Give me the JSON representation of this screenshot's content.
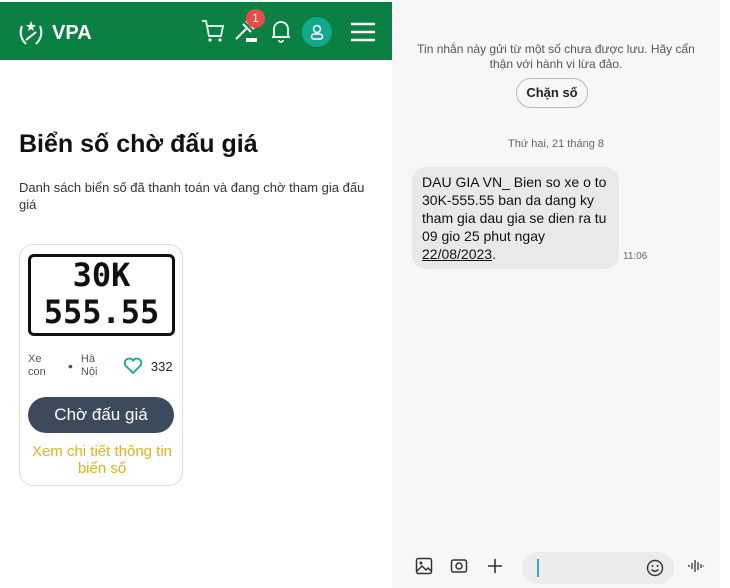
{
  "app": {
    "logo_text": "VPA",
    "notification_count": "1"
  },
  "page": {
    "title": "Biển số chờ đấu giá",
    "description": "Danh sách biển số đã thanh toán và đang chờ tham gia đấu giá"
  },
  "card": {
    "plate_line1": "30K",
    "plate_line2": "555.55",
    "vehicle_type": "Xe con",
    "location": "Hà Nội",
    "likes": "332",
    "status_button": "Chờ đấu giá",
    "detail_link": "Xem chi tiết thông tin biển số"
  },
  "sms": {
    "warning": "Tin nhắn này gửi từ một số chưa được lưu. Hãy cẩn thận với hành vi lừa đảo.",
    "block_button": "Chặn số",
    "date": "Thứ hai, 21 tháng 8",
    "message_text": "DAU GIA VN_ Bien so xe o to 30K-555.55 ban da dang ky tham gia dau gia se dien ra tu 09 gio 25 phut ngay ",
    "message_date": "22/08/2023",
    "message_end": ".",
    "time": "11:06"
  },
  "colors": {
    "brand_green": "#0a8043",
    "button_dark": "#3d4a5c",
    "link_yellow": "#e3b21c"
  }
}
